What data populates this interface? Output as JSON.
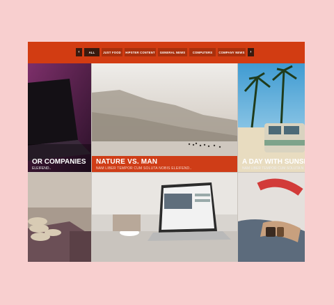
{
  "filters": {
    "prev_icon": "chevron-left-icon",
    "next_icon": "chevron-right-icon",
    "items": [
      {
        "label": "ALL",
        "active": true
      },
      {
        "label": "JUST FOOD",
        "active": false
      },
      {
        "label": "HIPSTER CONTENT",
        "active": false
      },
      {
        "label": "GENERAL NEWS",
        "active": false
      },
      {
        "label": "COMPUTERS",
        "active": false
      },
      {
        "label": "COMPANY NEWS",
        "active": false
      }
    ]
  },
  "tiles": {
    "companies": {
      "title": "OR COMPANIES",
      "subtitle": "ELEIFEND.."
    },
    "nature": {
      "title": "NATURE VS. MAN",
      "subtitle": "NAM LIBER TEMPOR CUM SOLUTA NOBIS ELEIFEND.."
    },
    "sunshine": {
      "title": "A DAY WITH SUNSH",
      "subtitle": "NAM LIBER TEMPOR CUM SOLUTA N"
    }
  },
  "colors": {
    "accent": "#d23c12",
    "page_background": "#f8cfcf",
    "active_filter": "#3a1a0e"
  }
}
